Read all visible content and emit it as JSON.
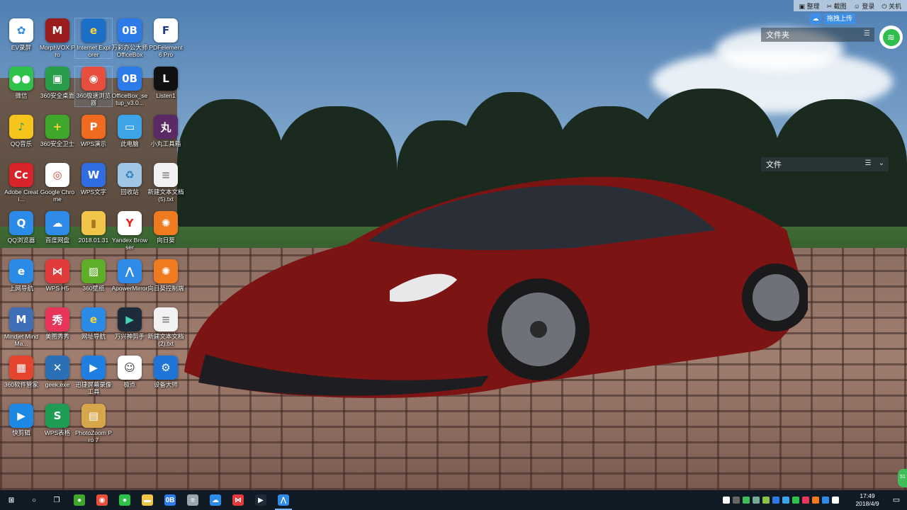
{
  "topbar": {
    "items": [
      "整理",
      "截图",
      "登录",
      "关机"
    ]
  },
  "upload": {
    "label": "拖拽上传"
  },
  "fences": [
    {
      "title": "文件夹"
    },
    {
      "title": "文件"
    }
  ],
  "desktop_icons": [
    {
      "label": "EV录屏",
      "color": "#ffffff",
      "glyph": "✿",
      "fg": "#2a8be6"
    },
    {
      "label": "MorphVOX Pro",
      "color": "#9a1c1c",
      "glyph": "M",
      "fg": "#fff"
    },
    {
      "label": "Internet Explorer",
      "color": "#1b6fc6",
      "glyph": "e",
      "fg": "#ffd23a"
    },
    {
      "label": "万彩办公大师OfficeBox",
      "color": "#2d7be8",
      "glyph": "0B",
      "fg": "#fff"
    },
    {
      "label": "PDFelement 6 Pro",
      "color": "#ffffff",
      "glyph": "F",
      "fg": "#1e3a8a"
    },
    {
      "label": "微信",
      "color": "#2ec24b",
      "glyph": "●●",
      "fg": "#fff"
    },
    {
      "label": "360安全桌面",
      "color": "#2a9d4a",
      "glyph": "▣",
      "fg": "#fff"
    },
    {
      "label": "360极速浏览器",
      "color": "#e84e3c",
      "glyph": "◉",
      "fg": "#fff"
    },
    {
      "label": "OfficeBox_setup_v3.0...",
      "color": "#2d7be8",
      "glyph": "0B",
      "fg": "#fff"
    },
    {
      "label": "Listen1",
      "color": "#111111",
      "glyph": "L",
      "fg": "#fff"
    },
    {
      "label": "QQ音乐",
      "color": "#f7c41b",
      "glyph": "♪",
      "fg": "#1f9d55"
    },
    {
      "label": "360安全卫士",
      "color": "#3fa82c",
      "glyph": "+",
      "fg": "#ffd13a"
    },
    {
      "label": "WPS演示",
      "color": "#f06a1f",
      "glyph": "P",
      "fg": "#fff"
    },
    {
      "label": "此电脑",
      "color": "#3da4e8",
      "glyph": "▭",
      "fg": "#fff"
    },
    {
      "label": "小丸工具箱",
      "color": "#5b2a66",
      "glyph": "丸",
      "fg": "#fff"
    },
    {
      "label": "Adobe Creati...",
      "color": "#d8232a",
      "glyph": "Cc",
      "fg": "#fff"
    },
    {
      "label": "Google Chrome",
      "color": "#ffffff",
      "glyph": "◎",
      "fg": "#db4437"
    },
    {
      "label": "WPS文字",
      "color": "#2f6ee2",
      "glyph": "W",
      "fg": "#fff"
    },
    {
      "label": "回收站",
      "color": "#9fc6e6",
      "glyph": "♻",
      "fg": "#2c7fbd"
    },
    {
      "label": "新建文本文档 (5).txt",
      "color": "#f2f2f2",
      "glyph": "≡",
      "fg": "#888"
    },
    {
      "label": "QQ浏览器",
      "color": "#2c8be8",
      "glyph": "Q",
      "fg": "#fff"
    },
    {
      "label": "百度网盘",
      "color": "#2f8be8",
      "glyph": "☁",
      "fg": "#fff"
    },
    {
      "label": "2018.01.31",
      "color": "#f1c54a",
      "glyph": "▮",
      "fg": "#a47a1c"
    },
    {
      "label": "Yandex Browser",
      "color": "#ffffff",
      "glyph": "Y",
      "fg": "#e42525"
    },
    {
      "label": "向日葵",
      "color": "#f07a1f",
      "glyph": "✺",
      "fg": "#fff"
    },
    {
      "label": "上网导航",
      "color": "#2a8be6",
      "glyph": "e",
      "fg": "#fff"
    },
    {
      "label": "WPS H5",
      "color": "#e23b3b",
      "glyph": "⋈",
      "fg": "#fff"
    },
    {
      "label": "360壁纸",
      "color": "#5fae2a",
      "glyph": "▨",
      "fg": "#fff"
    },
    {
      "label": "ApowerMirror",
      "color": "#2f8be8",
      "glyph": "⋀",
      "fg": "#fff"
    },
    {
      "label": "向日葵控制端",
      "color": "#f07a1f",
      "glyph": "✺",
      "fg": "#fff"
    },
    {
      "label": "Mindjet MindMa...",
      "color": "#3f6fb7",
      "glyph": "M",
      "fg": "#fff"
    },
    {
      "label": "美图秀秀",
      "color": "#e8365a",
      "glyph": "秀",
      "fg": "#fff"
    },
    {
      "label": "网址导航",
      "color": "#2a8be6",
      "glyph": "e",
      "fg": "#ffd23a"
    },
    {
      "label": "万兴神剪手",
      "color": "#1d2b3a",
      "glyph": "▶",
      "fg": "#42d8b8"
    },
    {
      "label": "新建文本文档 (2).txt",
      "color": "#f2f2f2",
      "glyph": "≡",
      "fg": "#888"
    },
    {
      "label": "360软件管家",
      "color": "#e5452f",
      "glyph": "▦",
      "fg": "#fff"
    },
    {
      "label": "geek.exe",
      "color": "#2b6fb5",
      "glyph": "✕",
      "fg": "#fff"
    },
    {
      "label": "迅捷屏幕录像工具",
      "color": "#1e7fe0",
      "glyph": "▶",
      "fg": "#fff"
    },
    {
      "label": "极点",
      "color": "#ffffff",
      "glyph": "☺",
      "fg": "#333"
    },
    {
      "label": "设备大师",
      "color": "#1f74d8",
      "glyph": "⚙",
      "fg": "#fff"
    },
    {
      "label": "快剪辑",
      "color": "#1e88e5",
      "glyph": "▶",
      "fg": "#fff"
    },
    {
      "label": "WPS表格",
      "color": "#1f9d55",
      "glyph": "S",
      "fg": "#fff"
    },
    {
      "label": "PhotoZoom Pro 7",
      "color": "#d8a64a",
      "glyph": "▤",
      "fg": "#fff"
    }
  ],
  "taskbar": {
    "apps": [
      {
        "name": "start",
        "glyph": "⊞",
        "color": "transparent"
      },
      {
        "name": "search",
        "glyph": "○",
        "color": "transparent"
      },
      {
        "name": "task-view",
        "glyph": "❐",
        "color": "transparent"
      },
      {
        "name": "360-security",
        "glyph": "●",
        "color": "#3fa82c"
      },
      {
        "name": "360-browser",
        "glyph": "◉",
        "color": "#e84e3c"
      },
      {
        "name": "wechat",
        "glyph": "●",
        "color": "#2ec24b"
      },
      {
        "name": "file-explorer",
        "glyph": "▬",
        "color": "#f1c54a"
      },
      {
        "name": "officebox",
        "glyph": "0B",
        "color": "#2d7be8"
      },
      {
        "name": "notepad",
        "glyph": "≡",
        "color": "#9aa6b2"
      },
      {
        "name": "baidu-netdisk",
        "glyph": "☁",
        "color": "#2f8be8"
      },
      {
        "name": "wps-h5",
        "glyph": "⋈",
        "color": "#e23b3b"
      },
      {
        "name": "filmora",
        "glyph": "▶",
        "color": "#1d2b3a"
      },
      {
        "name": "apowermirror",
        "glyph": "⋀",
        "color": "#2f8be8"
      }
    ],
    "clock_time": "17:49",
    "clock_date": "2018/4/9"
  },
  "side_widget": {
    "label": "51"
  }
}
